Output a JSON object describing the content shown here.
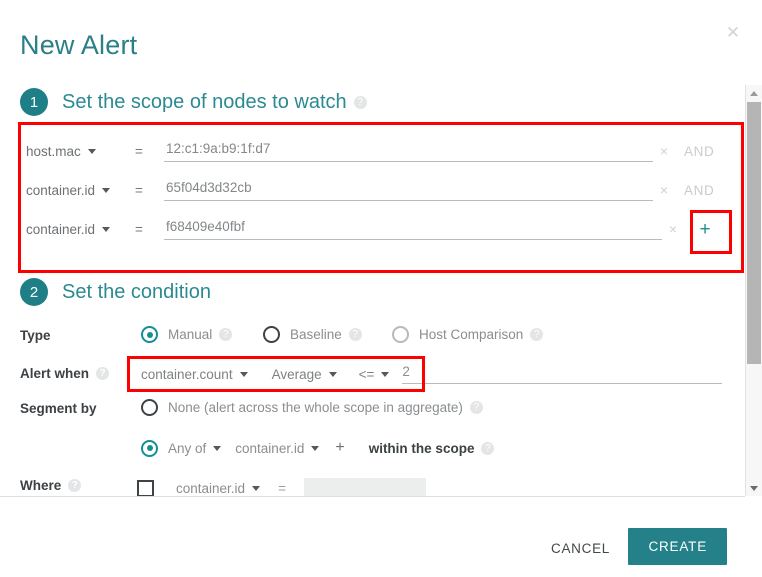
{
  "dialog": {
    "title": "New Alert",
    "close_icon": "close-icon"
  },
  "steps": [
    {
      "number": "1",
      "title": "Set the scope of nodes to watch",
      "help": "?"
    },
    {
      "number": "2",
      "title": "Set the condition",
      "help": "?"
    }
  ],
  "scope": {
    "rows": [
      {
        "field": "host.mac",
        "operator": "=",
        "value": "12:c1:9a:b9:1f:d7",
        "remove_icon": "×",
        "conjunction": "AND"
      },
      {
        "field": "container.id",
        "operator": "=",
        "value": "65f04d3d32cb",
        "remove_icon": "×",
        "conjunction": "AND"
      },
      {
        "field": "container.id",
        "operator": "=",
        "value": "f68409e40fbf",
        "remove_icon": "×",
        "conjunction": ""
      }
    ],
    "add_button": "+"
  },
  "condition": {
    "type_label": "Type",
    "type_help": "?",
    "type_options": [
      {
        "label": "Manual",
        "selected": true,
        "help": "?"
      },
      {
        "label": "Baseline",
        "selected": false,
        "help": "?"
      },
      {
        "label": "Host Comparison",
        "selected": false,
        "help": "?"
      }
    ],
    "alert_when_label": "Alert when",
    "alert_when_help": "?",
    "metric": "container.count",
    "aggregation": "Average",
    "comparator": "<=",
    "threshold": "2",
    "segment_label": "Segment by",
    "segment_none_label": "None (alert across the whole scope in aggregate)",
    "segment_none_help": "?",
    "segment_none_selected": false,
    "segment_anyof_label": "Any of",
    "segment_anyof_selected": true,
    "segment_field": "container.id",
    "segment_add": "+",
    "segment_scope_text": "within the scope",
    "segment_scope_help": "?",
    "where_label": "Where",
    "where_help": "?",
    "where_field": "container.id",
    "where_operator": "=",
    "where_value": ""
  },
  "footer": {
    "cancel_label": "CANCEL",
    "create_label": "CREATE"
  },
  "colors": {
    "accent": "#24818a",
    "highlight": "#fe0000",
    "title": "#2b7f87"
  }
}
